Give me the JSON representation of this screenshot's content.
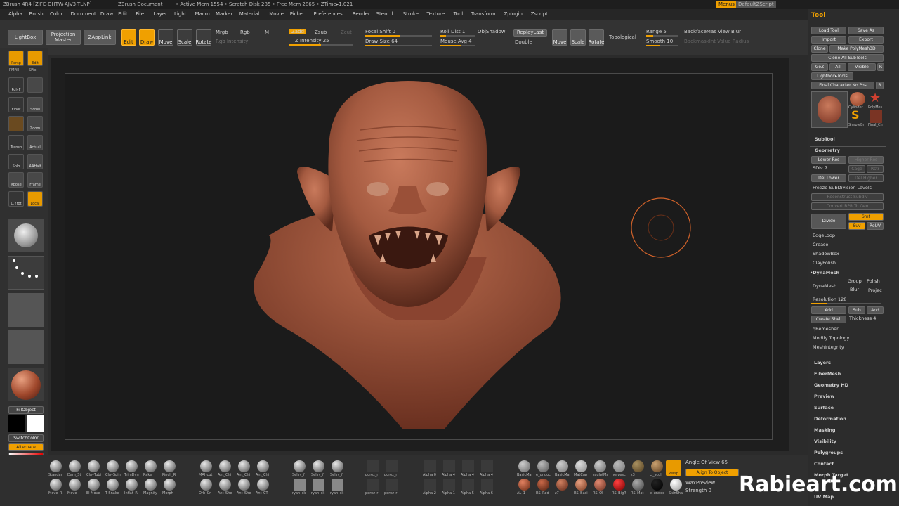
{
  "titlebar": {
    "app": "ZBrush 4R4 [ZIFE-GHTW-AJV3-TLNP]",
    "doc": "ZBrush Document",
    "mem": "• Active Mem 1554 • Scratch Disk 285 • Free Mem 2865 • ZTime▸1.021",
    "menus": "Menus",
    "script": "DefaultZScript"
  },
  "menubar": [
    "Alpha",
    "Brush",
    "Color",
    "Document",
    "Draw",
    "Edit",
    "File",
    "Layer",
    "Light",
    "Macro",
    "Marker",
    "Material",
    "Movie",
    "Picker",
    "Preferences",
    "Render",
    "Stencil",
    "Stroke",
    "Texture",
    "Tool",
    "Transform",
    "Zplugin",
    "Zscript"
  ],
  "shelf": {
    "lightbox": "LightBox",
    "projection_master": "Projection Master",
    "zapplink": "ZAppLink",
    "edit": "Edit",
    "draw": "Draw",
    "move": "Move",
    "scale": "Scale",
    "rotate": "Rotate",
    "mrgb": "Mrgb",
    "rgb": "Rgb",
    "m": "M",
    "rgb_intensity": "Rgb Intensity",
    "zadd": "Zadd",
    "zsub": "Zsub",
    "zcut": "Zcut",
    "z_intensity": "Z Intensity 25",
    "focal_shift": "Focal Shift 0",
    "draw_size": "Draw Size 64",
    "roll_dist": "Roll Dist 1",
    "mouse_avg": "Mouse Avg 4",
    "objshadow": "ObjShadow",
    "replaylast": "ReplayLast",
    "double": "Double",
    "move2": "Move",
    "scale2": "Scale",
    "rotate2": "Rotate",
    "topological": "Topological",
    "range": "Range 5",
    "smooth": "Smooth 10",
    "backfacemask": "BackfaceMas View Blur",
    "backmask": "BackmaskInt Value Radius"
  },
  "lefttray": {
    "persp": "Persp",
    "edit": "Edit",
    "pmfill": "PMFill",
    "spix": "SPix",
    "polyf": "PolyF",
    "floor": "Floor",
    "scroll": "Scroll",
    "zoom": "Zoom",
    "transp": "Transp",
    "actual": "Actual",
    "solo": "Solo",
    "aahalf": "AAHalf",
    "xpose": "Xpose",
    "frame": "Frame",
    "cyrot": "C.Yrot",
    "local": "Local",
    "fillobject": "FillObject",
    "switchcolor": "SwitchColor",
    "alternate": "Alternate"
  },
  "tool_panel": {
    "title": "Tool",
    "load_tool": "Load Tool",
    "save_as": "Save As",
    "import": "Import",
    "export": "Export",
    "clone": "Clone",
    "make_polymesh": "Make PolyMesh3D",
    "clone_all": "Clone All SubTools",
    "goz": "GoZ",
    "all": "All",
    "visible": "Visible",
    "r": "R",
    "lightbox_tools": "Lightbox▸Tools",
    "final_char": "Final Character No Pos",
    "thumb_cylinder": "Cylinder",
    "thumb_polymesh": "PolyMes",
    "thumb_simple": "SimpleBr",
    "thumb_final": "Final_Ch",
    "subtool": "SubTool",
    "geometry": "Geometry",
    "lower_res": "Lower Res",
    "higher_res": "Higher Res",
    "sdiv": "SDiv 7",
    "cage": "Cage",
    "rstr": "Rstr",
    "del_lower": "Del Lower",
    "del_higher": "Del Higher",
    "freeze": "Freeze SubDivision Levels",
    "reconstruct": "Reconstruct Subdiv",
    "convert_bpr": "Convert BPR To Geo",
    "divide": "Divide",
    "smt": "Smt",
    "suv": "Suv",
    "reuv": "ReUV",
    "edgeloop": "EdgeLoop",
    "crease": "Crease",
    "shadowbox": "ShadowBox",
    "claypolish": "ClayPolish",
    "dynamesh_hdr": "•DynaMesh",
    "dynamesh": "DynaMesh",
    "group": "Group",
    "polish": "Polish",
    "blur": "Blur",
    "project": "Projec",
    "resolution": "Resolution 128",
    "add": "Add",
    "sub": "Sub",
    "and": "And",
    "create_shell": "Create Shell",
    "thickness": "Thickness 4",
    "qremesher": "qRemesher",
    "modify_topology": "Modify Topology",
    "meshintegrity": "MeshIntegrity",
    "layers": "Layers",
    "fibermesh": "FiberMesh",
    "geometry_hd": "Geometry HD",
    "preview": "Preview",
    "surface": "Surface",
    "deformation": "Deformation",
    "masking": "Masking",
    "visibility": "Visibility",
    "polygroups": "Polygroups",
    "contact": "Contact",
    "morph_target": "Morph Target",
    "uv_map": "UV Map"
  },
  "bottomtray": {
    "brushes_row1": [
      "Standar",
      "Dam_St",
      "ClayTubi",
      "ClaySpin",
      "TrimDyn",
      "Rake",
      "Pinch_R"
    ],
    "brushes_row2": [
      "Move_R",
      "Move",
      "El Move",
      "T-Snake",
      "Inflat_R",
      "Magnify",
      "Morph"
    ],
    "brushes2_row1": [
      "MAHcut",
      "Ant_Chi",
      "Ant_Chi",
      "Ant_Chi"
    ],
    "brushes2_row2": [
      "Orb_Cr",
      "Ant_She",
      "Ant_She",
      "Ant_CT"
    ],
    "brushes3_row1": [
      "Selvy_f",
      "Selvy_f",
      "Selvy_f"
    ],
    "brushes3_row2": [
      "ryan_sk",
      "ryan_sk",
      "ryan_sk"
    ],
    "pores_row1": [
      "porez_r",
      "porez_r"
    ],
    "pores_row2": [
      "porez_r",
      "porez_r"
    ],
    "alpha_row1": [
      "Alpha 0",
      "Alpha 4",
      "Alpha 4",
      "Alpha 4"
    ],
    "alpha_row2": [
      "Alpha 2",
      "Alpha 1",
      "Alpha 5",
      "Alpha 6"
    ],
    "mat_row1": [
      "BasicMa",
      "e_undoc",
      "BasicMa",
      "MatCap",
      "sculptMa",
      "nervesc",
      "z3",
      "LI_scul"
    ],
    "mat_row2": [
      "AL_1",
      "RS_Red",
      "z7",
      "RS_Basi",
      "RS_Ol",
      "RS_BigR",
      "RS_Mat",
      "e_undoc",
      "SkinSha"
    ],
    "persp": "Persp",
    "angle_of_view": "Angle Of View 65",
    "align_to_object": "Align To Object",
    "waxpreview": "WaxPreview",
    "strength": "Strength 0"
  },
  "watermark": "Rabieart.com",
  "colors": {
    "accent": "#f0a000",
    "clay": "#a45a40",
    "canvas": "#1b1b1b"
  }
}
